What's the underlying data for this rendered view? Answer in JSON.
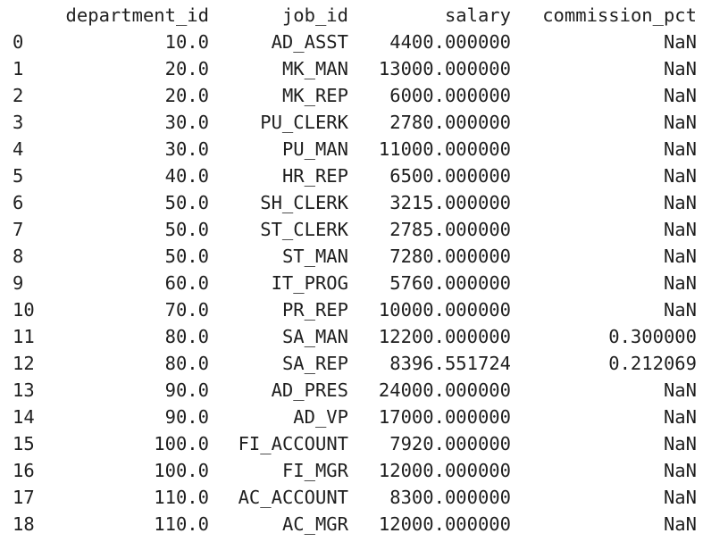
{
  "table": {
    "columns": [
      "department_id",
      "job_id",
      "salary",
      "commission_pct"
    ],
    "rows": [
      {
        "index": "0",
        "department_id": "10.0",
        "job_id": "AD_ASST",
        "salary": "4400.000000",
        "commission_pct": "NaN"
      },
      {
        "index": "1",
        "department_id": "20.0",
        "job_id": "MK_MAN",
        "salary": "13000.000000",
        "commission_pct": "NaN"
      },
      {
        "index": "2",
        "department_id": "20.0",
        "job_id": "MK_REP",
        "salary": "6000.000000",
        "commission_pct": "NaN"
      },
      {
        "index": "3",
        "department_id": "30.0",
        "job_id": "PU_CLERK",
        "salary": "2780.000000",
        "commission_pct": "NaN"
      },
      {
        "index": "4",
        "department_id": "30.0",
        "job_id": "PU_MAN",
        "salary": "11000.000000",
        "commission_pct": "NaN"
      },
      {
        "index": "5",
        "department_id": "40.0",
        "job_id": "HR_REP",
        "salary": "6500.000000",
        "commission_pct": "NaN"
      },
      {
        "index": "6",
        "department_id": "50.0",
        "job_id": "SH_CLERK",
        "salary": "3215.000000",
        "commission_pct": "NaN"
      },
      {
        "index": "7",
        "department_id": "50.0",
        "job_id": "ST_CLERK",
        "salary": "2785.000000",
        "commission_pct": "NaN"
      },
      {
        "index": "8",
        "department_id": "50.0",
        "job_id": "ST_MAN",
        "salary": "7280.000000",
        "commission_pct": "NaN"
      },
      {
        "index": "9",
        "department_id": "60.0",
        "job_id": "IT_PROG",
        "salary": "5760.000000",
        "commission_pct": "NaN"
      },
      {
        "index": "10",
        "department_id": "70.0",
        "job_id": "PR_REP",
        "salary": "10000.000000",
        "commission_pct": "NaN"
      },
      {
        "index": "11",
        "department_id": "80.0",
        "job_id": "SA_MAN",
        "salary": "12200.000000",
        "commission_pct": "0.300000"
      },
      {
        "index": "12",
        "department_id": "80.0",
        "job_id": "SA_REP",
        "salary": "8396.551724",
        "commission_pct": "0.212069"
      },
      {
        "index": "13",
        "department_id": "90.0",
        "job_id": "AD_PRES",
        "salary": "24000.000000",
        "commission_pct": "NaN"
      },
      {
        "index": "14",
        "department_id": "90.0",
        "job_id": "AD_VP",
        "salary": "17000.000000",
        "commission_pct": "NaN"
      },
      {
        "index": "15",
        "department_id": "100.0",
        "job_id": "FI_ACCOUNT",
        "salary": "7920.000000",
        "commission_pct": "NaN"
      },
      {
        "index": "16",
        "department_id": "100.0",
        "job_id": "FI_MGR",
        "salary": "12000.000000",
        "commission_pct": "NaN"
      },
      {
        "index": "17",
        "department_id": "110.0",
        "job_id": "AC_ACCOUNT",
        "salary": "8300.000000",
        "commission_pct": "NaN"
      },
      {
        "index": "18",
        "department_id": "110.0",
        "job_id": "AC_MGR",
        "salary": "12000.000000",
        "commission_pct": "NaN"
      }
    ]
  },
  "colors": {
    "text": "#1f1f1f",
    "background": "#ffffff"
  }
}
